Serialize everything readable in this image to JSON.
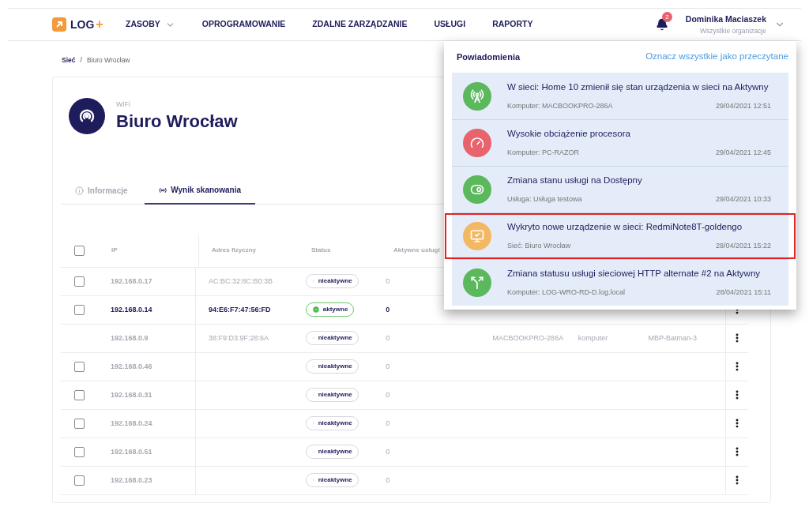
{
  "header": {
    "logo": "LOG",
    "logo_mark": "+",
    "nav": [
      {
        "label": "ZASOBY",
        "dropdown": true
      },
      {
        "label": "OPROGRAMOWANIE",
        "dropdown": false
      },
      {
        "label": "ZDALNE ZARZĄDZANIE",
        "dropdown": false
      },
      {
        "label": "USŁUGI",
        "dropdown": false
      },
      {
        "label": "RAPORTY",
        "dropdown": false
      }
    ],
    "notification_count": "2",
    "user": {
      "name": "Dominika Maciaszek",
      "org": "Wszystkie organizacje"
    }
  },
  "breadcrumb": {
    "items": [
      "Sieć",
      "Biuro Wrocław"
    ],
    "separator": "/"
  },
  "network": {
    "type": "WiFi",
    "name": "Biuro Wrocław"
  },
  "tabs": [
    {
      "label": "Informacje",
      "kind": "info",
      "selected": false
    },
    {
      "label": "Wynik skanowania",
      "kind": "scan",
      "selected": true
    }
  ],
  "table": {
    "select_all": {
      "checked": false
    },
    "columns": [
      "IP",
      "Adres fizyczny",
      "Status",
      "Aktywne usługi"
    ],
    "rows": [
      {
        "menu": false,
        "checked": false,
        "ip": "192.168.0.17",
        "mac": "AC:BC:32:8C:B0:3B",
        "status": "nieaktywne",
        "active": false,
        "services": "0"
      },
      {
        "menu": true,
        "checked": false,
        "ip": "192.168.0.14",
        "mac": "94:E6:F7:47:56:FD",
        "status": "aktywne",
        "active": true,
        "services": "0"
      },
      {
        "menu": true,
        "ip": "192.168.0.9",
        "mac": "38:F9:D3:9F:28:6A",
        "status": "nieaktywne",
        "active": false,
        "services": "0",
        "column_6": "MACBOOKPRO-286A",
        "column_7": "komputer",
        "column_8": "MBP-Batman-3"
      },
      {
        "menu": true,
        "checked": false,
        "ip": "192.168.0.46",
        "status": "nieaktywne",
        "active": false,
        "services": "0"
      },
      {
        "menu": true,
        "checked": false,
        "ip": "192.168.0.31",
        "status": "nieaktywne",
        "active": false,
        "services": "0"
      },
      {
        "menu": true,
        "checked": false,
        "ip": "192.168.0.24",
        "status": "nieaktywne",
        "active": false,
        "services": "0"
      },
      {
        "menu": true,
        "checked": false,
        "ip": "192.168.0.51",
        "status": "nieaktywne",
        "active": false,
        "services": "0"
      },
      {
        "menu": true,
        "checked": false,
        "ip": "192.168.0.23",
        "status": "nieaktywne",
        "active": false,
        "services": "0"
      }
    ]
  },
  "notifications": {
    "title": "Powiadomienia",
    "mark_all": "Oznacz wszystkie jako przeczytane",
    "items": [
      {
        "kind": "antenna",
        "color": "#5cb85c",
        "title": "W sieci: Home 10 zmienił się stan urządzenia w sieci na Aktywny",
        "source": "Komputer: MACBOOKPRO-286A",
        "time": "29/04/2021 12:51",
        "highlighted": false
      },
      {
        "kind": "gauge",
        "color": "#e8636b",
        "title": "Wysokie obciążenie procesora",
        "source": "Komputer: PC-RAZOR",
        "time": "29/04/2021 12:45",
        "highlighted": false
      },
      {
        "kind": "toggle",
        "color": "#5cb85c",
        "title": "Zmiana stanu usługi na Dostępny",
        "source": "Usługa: Usługa testowa",
        "time": "29/04/2021 10:33",
        "highlighted": false
      },
      {
        "kind": "device",
        "color": "#f3b863",
        "title": "Wykryto nowe urządzenie w sieci: RedmiNote8T-goldengo",
        "source": "Sieć: Biuro Wrocław",
        "time": "28/04/2021 15:22",
        "highlighted": true
      },
      {
        "kind": "split",
        "color": "#5cb85c",
        "title": "Zmiana statusu usługi sieciowej HTTP alternate #2 na Aktywny",
        "source": "Komputer: LOG-WRO-RD-D.log.local",
        "time": "28/04/2021 15:11",
        "highlighted": false
      }
    ]
  }
}
